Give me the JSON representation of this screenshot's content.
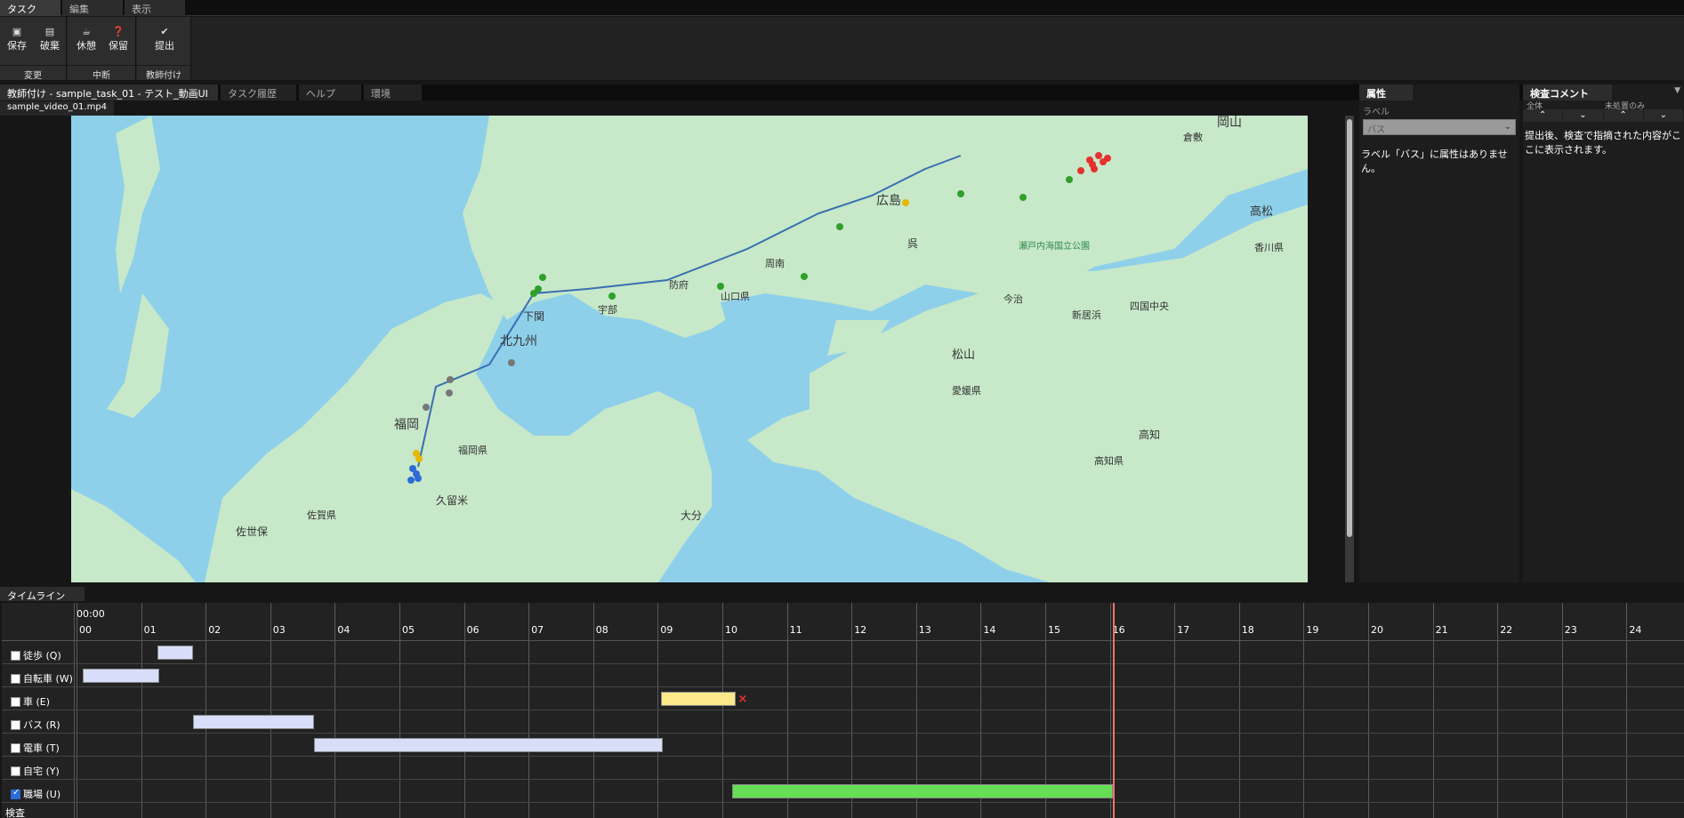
{
  "menu": [
    "タスク",
    "編集",
    "表示"
  ],
  "ribbon": {
    "groups": [
      {
        "label": "変更",
        "buttons": [
          {
            "label": "保存",
            "icon": "floppy-icon"
          },
          {
            "label": "破棄",
            "icon": "file-icon"
          }
        ]
      },
      {
        "label": "中断",
        "buttons": [
          {
            "label": "休憩",
            "icon": "coffee-icon"
          },
          {
            "label": "保留",
            "icon": "question-icon"
          }
        ]
      },
      {
        "label": "教師付け",
        "buttons": [
          {
            "label": "提出",
            "icon": "check-icon"
          }
        ]
      }
    ]
  },
  "tabs": [
    "教師付け - sample_task_01 - テスト_動画UI *",
    "タスク履歴",
    "ヘルプ",
    "環境"
  ],
  "file_tab": "sample_video_01.mp4",
  "map": {
    "labels": [
      {
        "text": "岡山"
      },
      {
        "text": "広島"
      },
      {
        "text": "下関"
      },
      {
        "text": "北九州"
      },
      {
        "text": "福岡"
      },
      {
        "text": "松山"
      },
      {
        "text": "高松"
      },
      {
        "text": "大分"
      },
      {
        "text": "高知"
      },
      {
        "text": "佐世保"
      },
      {
        "text": "久留米"
      },
      {
        "text": "山口県"
      },
      {
        "text": "福岡県"
      },
      {
        "text": "愛媛県"
      },
      {
        "text": "高知県"
      },
      {
        "text": "香川県"
      },
      {
        "text": "佐賀県"
      },
      {
        "text": "呉"
      },
      {
        "text": "瀬戸内海国立公園"
      },
      {
        "text": "倉敷"
      },
      {
        "text": "新居浜"
      },
      {
        "text": "今治"
      },
      {
        "text": "四国中央"
      },
      {
        "text": "宇部"
      },
      {
        "text": "防府"
      },
      {
        "text": "周南"
      }
    ],
    "colors": {
      "sea": "#8ed0ea",
      "land": "#c7e8c9",
      "route": "#3a6fb0",
      "green_dot": "#2fa02a",
      "gray_dot": "#777777",
      "red_dot": "#e53030",
      "blue_dot": "#2d6bd6",
      "yellow_dot": "#e6b800"
    }
  },
  "attributes": {
    "title": "属性",
    "label_caption": "ラベル",
    "selected_label": "バス",
    "message": "ラベル「バス」に属性はありません。"
  },
  "comments": {
    "title": "検査コメント",
    "filter_all": "全体",
    "filter_unresolved": "未処置のみ",
    "message": "提出後、検査で指摘された内容がここに表示されます。"
  },
  "timeline": {
    "title": "タイムライン",
    "time_label": "00:00",
    "hours": [
      "00",
      "01",
      "02",
      "03",
      "04",
      "05",
      "06",
      "07",
      "08",
      "09",
      "10",
      "11",
      "12",
      "13",
      "14",
      "15",
      "16",
      "17",
      "18",
      "19",
      "20",
      "21",
      "22",
      "23",
      "24"
    ],
    "rows": [
      {
        "label": "徒歩 (Q)",
        "checked": false
      },
      {
        "label": "自転車 (W)",
        "checked": false
      },
      {
        "label": "車 (E)",
        "checked": false
      },
      {
        "label": "バス (R)",
        "checked": false
      },
      {
        "label": "電車 (T)",
        "checked": false
      },
      {
        "label": "自宅 (Y)",
        "checked": false
      },
      {
        "label": "職場 (U)",
        "checked": true
      }
    ],
    "segments": [
      {
        "row": 0,
        "start": 1.25,
        "end": 1.8,
        "color": "#d8defa"
      },
      {
        "row": 1,
        "start": 0.1,
        "end": 1.28,
        "color": "#d8defa"
      },
      {
        "row": 2,
        "start": 9.05,
        "end": 10.2,
        "color": "#fde88a"
      },
      {
        "row": 3,
        "start": 1.8,
        "end": 3.68,
        "color": "#d8defa"
      },
      {
        "row": 4,
        "start": 3.68,
        "end": 9.08,
        "color": "#d8defa"
      },
      {
        "row": 6,
        "start": 10.15,
        "end": 16.05,
        "color": "#66dd55"
      }
    ],
    "cursor_hour": 16.05,
    "delete_mark": "×",
    "inspect_label": "検査"
  }
}
